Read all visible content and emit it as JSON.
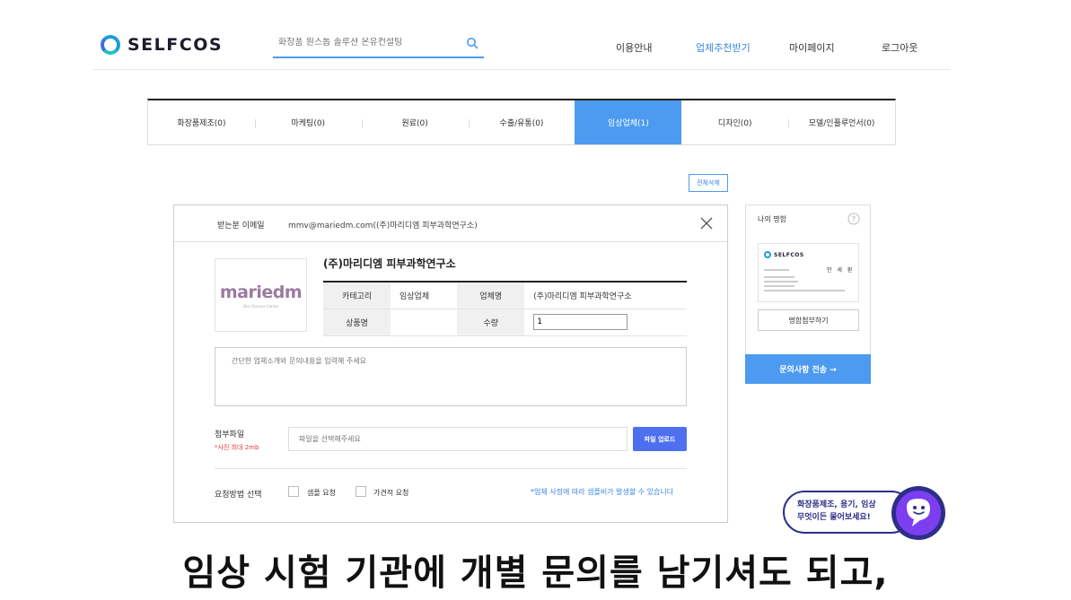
{
  "header": {
    "brand": "SELFCOS",
    "search_placeholder": "화장품 원스톱 솔루션 온유컨설팅",
    "nav": [
      "이용안내",
      "업체추천받기",
      "마이페이지",
      "로그아웃"
    ],
    "active_nav": "업체추천받기"
  },
  "tabs": [
    {
      "label": "화장품제조(0)"
    },
    {
      "label": "마케팅(0)"
    },
    {
      "label": "원료(0)"
    },
    {
      "label": "수출/유통(0)"
    },
    {
      "label": "임상업체(1)",
      "active": true
    },
    {
      "label": "디자인(0)"
    },
    {
      "label": "모델/인플루언서(0)"
    }
  ],
  "delete_all": "전체삭제",
  "modal": {
    "recipient_label": "받는분 이메일",
    "recipient_email": "mmv@mariedm.com((주)마리디엠 피부과학연구소)",
    "company_logo_text": "mariedm",
    "company_logo_sub": "Skin Science Center",
    "company_name": "(주)마리디엠 피부과학연구소",
    "table": {
      "category_label": "카테고리",
      "category_value": "임상업체",
      "vendor_label": "업체명",
      "vendor_value": "(주)마리디엠 피부과학연구소",
      "product_label": "상품명",
      "product_value": "",
      "qty_label": "수량",
      "qty_value": "1"
    },
    "message_placeholder": "간단한 업체소개와 문의내용을 입력해 주세요",
    "attach_label": "첨부파일",
    "attach_note": "*사진 최대 2mb",
    "file_placeholder": "파일을 선택해주세요",
    "upload_button": "파일 업로드",
    "method_label": "요청방법 선택",
    "sample_request": "샘플 요청",
    "quote_request": "가견적 요청",
    "sample_note": "*업체 사정에 따라 샘플비가 발생할 수 있습니다"
  },
  "card_panel": {
    "title": "나의 명함",
    "card_brand": "SELFCOS",
    "card_name": "안 세 환",
    "attach_button": "명함첨부하기",
    "send_button": "문의사항 전송 →"
  },
  "chat": {
    "line1": "화장품제조, 용기, 임상",
    "line2": "무엇이든 물어보세요!"
  },
  "subtitle": "임상 시험 기관에 개별 문의를 남기셔도 되고,",
  "colors": {
    "accent": "#4c9bf0",
    "upload": "#4d6ff0",
    "chat_border": "#2c2e8a",
    "bot": "#7b3ff0",
    "note_red": "#e0403a"
  }
}
